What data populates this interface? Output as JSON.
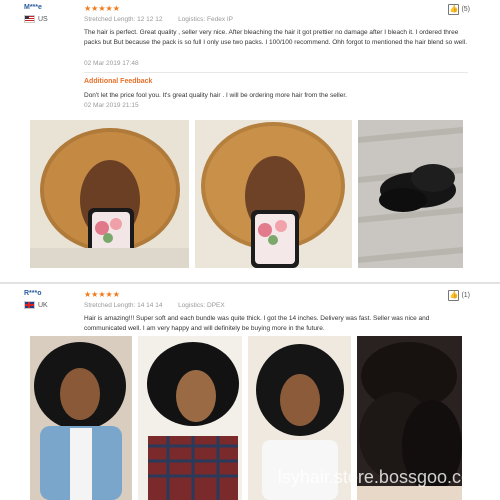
{
  "reviews": [
    {
      "user": "M***e",
      "country": "US",
      "stars": "★★★★★",
      "stretched_label": "Stretched Length:",
      "stretched_value": "12 12 12",
      "logistics_label": "Logistics:",
      "logistics_value": "Fedex IP",
      "likes": "(5)",
      "text": "The hair is perfect. Great quality , seller very nice. After bleaching the hair it got prettier no damage after I bleach it. I ordered three packs but But because the pack is so full I only use two packs. I 100/100 recommend. Ohh forgot to mentioned the hair blend so well.",
      "date": "02 Mar 2019 17:48",
      "feedback_title": "Additional Feedback",
      "feedback_text": "Don't let the price fool you. It's great quality hair . I will be ordering more hair from the seller.",
      "feedback_date": "02 Mar 2019 21:15"
    },
    {
      "user": "R***o",
      "country": "UK",
      "stars": "★★★★★",
      "stretched_label": "Stretched Length:",
      "stretched_value": "14 14 14",
      "logistics_label": "Logistics:",
      "logistics_value": "DPEX",
      "likes": "(1)",
      "text": "Hair is amazing!!! Super soft and each bundle was quite thick. I got the 14 inches. Delivery was fast. Seller was nice and communicated well. I am very happy and will definitely be buying more in the future."
    }
  ],
  "watermark": "lsyhair.store.bossgoo.com",
  "colors": {
    "accent": "#f07a1a",
    "link": "#2a5d9f"
  }
}
